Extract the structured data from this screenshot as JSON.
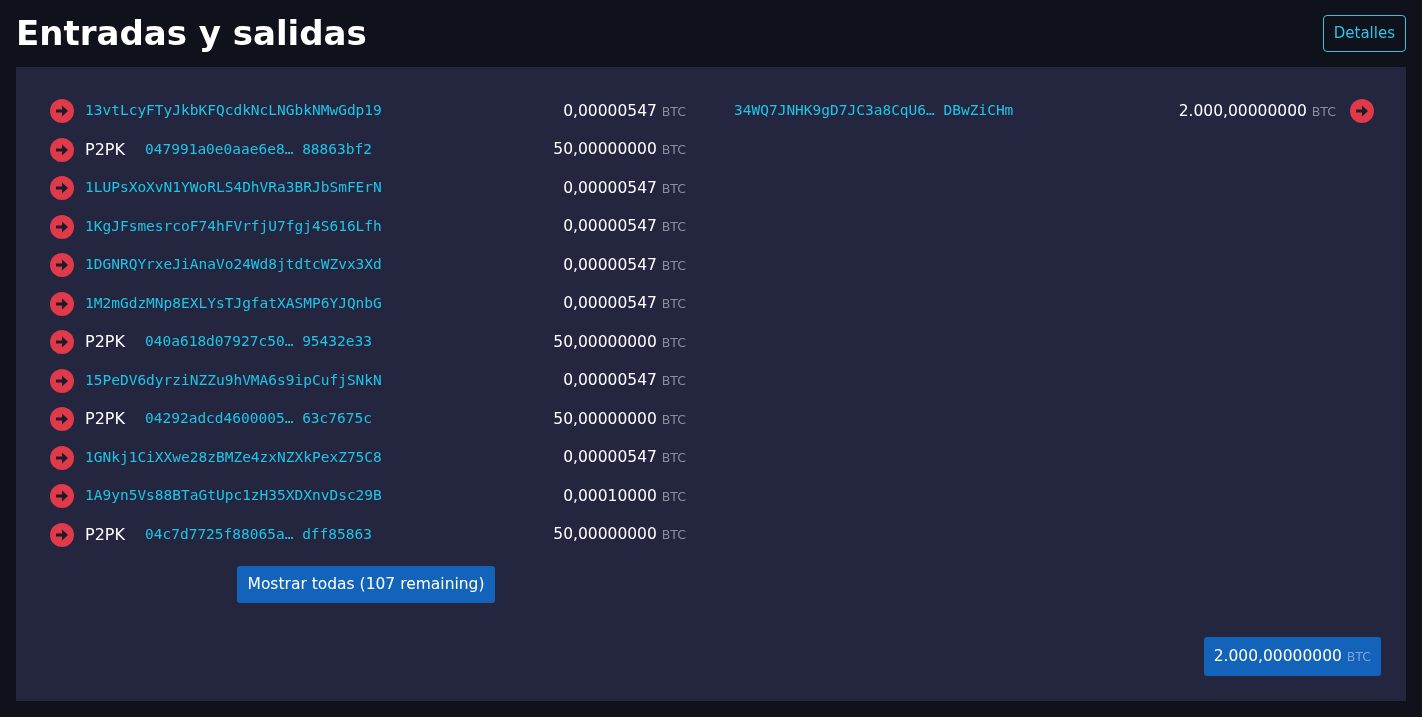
{
  "title": "Entradas y salidas",
  "details_button": "Detalles",
  "inputs": [
    {
      "kind": "address",
      "address": "13vtLcyFTyJkbKFQcdkNcLNGbkNMwGdp19",
      "amount": "0,00000547",
      "unit": "BTC"
    },
    {
      "kind": "p2pk",
      "label": "P2PK",
      "address": "047991a0e0aae6e8… 88863bf2",
      "amount": "50,00000000",
      "unit": "BTC"
    },
    {
      "kind": "address",
      "address": "1LUPsXoXvN1YWoRLS4DhVRa3BRJbSmFErN",
      "amount": "0,00000547",
      "unit": "BTC"
    },
    {
      "kind": "address",
      "address": "1KgJFsmesrcoF74hFVrfjU7fgj4S616Lfh",
      "amount": "0,00000547",
      "unit": "BTC"
    },
    {
      "kind": "address",
      "address": "1DGNRQYrxeJiAnaVo24Wd8jtdtcWZvx3Xd",
      "amount": "0,00000547",
      "unit": "BTC"
    },
    {
      "kind": "address",
      "address": "1M2mGdzMNp8EXLYsTJgfatXASMP6YJQnbG",
      "amount": "0,00000547",
      "unit": "BTC"
    },
    {
      "kind": "p2pk",
      "label": "P2PK",
      "address": "040a618d07927c50… 95432e33",
      "amount": "50,00000000",
      "unit": "BTC"
    },
    {
      "kind": "address",
      "address": "15PeDV6dyrziNZZu9hVMA6s9ipCufjSNkN",
      "amount": "0,00000547",
      "unit": "BTC"
    },
    {
      "kind": "p2pk",
      "label": "P2PK",
      "address": "04292adcd4600005… 63c7675c",
      "amount": "50,00000000",
      "unit": "BTC"
    },
    {
      "kind": "address",
      "address": "1GNkj1CiXXwe28zBMZe4zxNZXkPexZ75C8",
      "amount": "0,00000547",
      "unit": "BTC"
    },
    {
      "kind": "address",
      "address": "1A9yn5Vs88BTaGtUpc1zH35XDXnvDsc29B",
      "amount": "0,00010000",
      "unit": "BTC"
    },
    {
      "kind": "p2pk",
      "label": "P2PK",
      "address": "04c7d7725f88065a… dff85863",
      "amount": "50,00000000",
      "unit": "BTC"
    }
  ],
  "show_all_button": "Mostrar todas (107 remaining)",
  "outputs": [
    {
      "address": "34WQ7JNHK9gD7JC3a8CqU6… DBwZiCHm",
      "amount": "2.000,00000000",
      "unit": "BTC"
    }
  ],
  "total": {
    "amount": "2.000,00000000",
    "unit": "BTC"
  }
}
